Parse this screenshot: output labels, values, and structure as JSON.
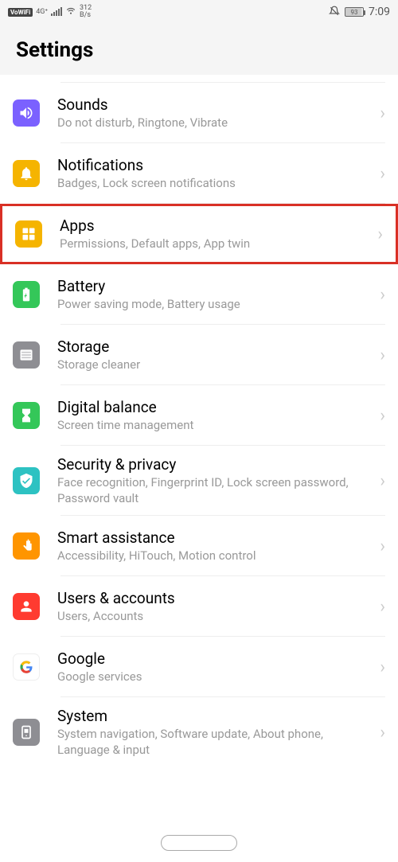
{
  "status": {
    "vowifi": "VoWiFi",
    "network": "4G⁺",
    "speed_top": "312",
    "speed_bottom": "B/s",
    "battery": "93",
    "time": "7:09"
  },
  "header": {
    "title": "Settings"
  },
  "items": [
    {
      "id": "sounds",
      "title": "Sounds",
      "subtitle": "Do not disturb, Ringtone, Vibrate",
      "color": "#7b61ff",
      "icon": "sound"
    },
    {
      "id": "notifications",
      "title": "Notifications",
      "subtitle": "Badges, Lock screen notifications",
      "color": "#f5b400",
      "icon": "bell"
    },
    {
      "id": "apps",
      "title": "Apps",
      "subtitle": "Permissions, Default apps, App twin",
      "color": "#f5b400",
      "icon": "apps",
      "highlighted": true
    },
    {
      "id": "battery",
      "title": "Battery",
      "subtitle": "Power saving mode, Battery usage",
      "color": "#34c759",
      "icon": "battery"
    },
    {
      "id": "storage",
      "title": "Storage",
      "subtitle": "Storage cleaner",
      "color": "#8e8e93",
      "icon": "storage"
    },
    {
      "id": "digital-balance",
      "title": "Digital balance",
      "subtitle": "Screen time management",
      "color": "#34c759",
      "icon": "hourglass"
    },
    {
      "id": "security",
      "title": "Security & privacy",
      "subtitle": "Face recognition, Fingerprint ID, Lock screen password, Password vault",
      "color": "#2dc2c2",
      "icon": "shield"
    },
    {
      "id": "smart-assistance",
      "title": "Smart assistance",
      "subtitle": "Accessibility, HiTouch, Motion control",
      "color": "#ff9500",
      "icon": "hand"
    },
    {
      "id": "users",
      "title": "Users & accounts",
      "subtitle": "Users, Accounts",
      "color": "#ff3b30",
      "icon": "person"
    },
    {
      "id": "google",
      "title": "Google",
      "subtitle": "Google services",
      "color": "#ffffff",
      "icon": "google"
    },
    {
      "id": "system",
      "title": "System",
      "subtitle": "System navigation, Software update, About phone, Language & input",
      "color": "#8e8e93",
      "icon": "system"
    }
  ]
}
